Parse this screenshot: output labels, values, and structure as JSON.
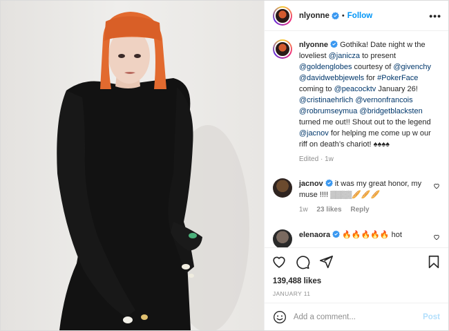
{
  "post": {
    "author": "nlyonne",
    "follow_label": "Follow",
    "separator": "•",
    "more_label": "•••"
  },
  "caption": {
    "username": "nlyonne",
    "text_parts": [
      {
        "t": "Gothika! Date night w the loveliest ",
        "link": false
      },
      {
        "t": "@janicza",
        "link": true
      },
      {
        "t": " to present ",
        "link": false
      },
      {
        "t": "@goldenglobes",
        "link": true
      },
      {
        "t": " courtesy of ",
        "link": false
      },
      {
        "t": "@givenchy",
        "link": true
      },
      {
        "t": " ",
        "link": false
      },
      {
        "t": "@davidwebbjewels",
        "link": true
      },
      {
        "t": " for ",
        "link": false
      },
      {
        "t": "#PokerFace",
        "link": true
      },
      {
        "t": " coming to ",
        "link": false
      },
      {
        "t": "@peacocktv",
        "link": true
      },
      {
        "t": " January 26! ",
        "link": false
      },
      {
        "t": "@cristinaehrlich",
        "link": true
      },
      {
        "t": " ",
        "link": false
      },
      {
        "t": "@vernonfrancois",
        "link": true
      },
      {
        "t": " ",
        "link": false
      },
      {
        "t": "@robrumseymua",
        "link": true
      },
      {
        "t": " ",
        "link": false
      },
      {
        "t": "@bridgetblacksten",
        "link": true
      },
      {
        "t": " turned me out!! Shout out to the legend ",
        "link": false
      },
      {
        "t": "@jacnov",
        "link": true
      },
      {
        "t": " for helping me come up w our riff on death’s chariot! ♠♠♠♠",
        "link": false
      }
    ],
    "edited": "Edited · 1w"
  },
  "comments": [
    {
      "username": "jacnov",
      "text": " it was my great honor, my muse !!!! ▒▒▒▒🥖🥖🥖",
      "time": "1w",
      "likes": "23 likes",
      "reply_label": "Reply"
    },
    {
      "username": "elenaora",
      "text": " 🔥🔥🔥🔥🔥 hot"
    }
  ],
  "likes_count": "139,488 likes",
  "post_date": "JANUARY 11",
  "add_comment": {
    "placeholder": "Add a comment...",
    "post_label": "Post"
  },
  "colors": {
    "accent": "#0095f6",
    "link": "#00376b",
    "verified": "#3897f0"
  },
  "icons": [
    "verified-icon",
    "more-icon",
    "heart-icon",
    "comment-icon",
    "share-icon",
    "bookmark-icon",
    "emoji-icon"
  ]
}
